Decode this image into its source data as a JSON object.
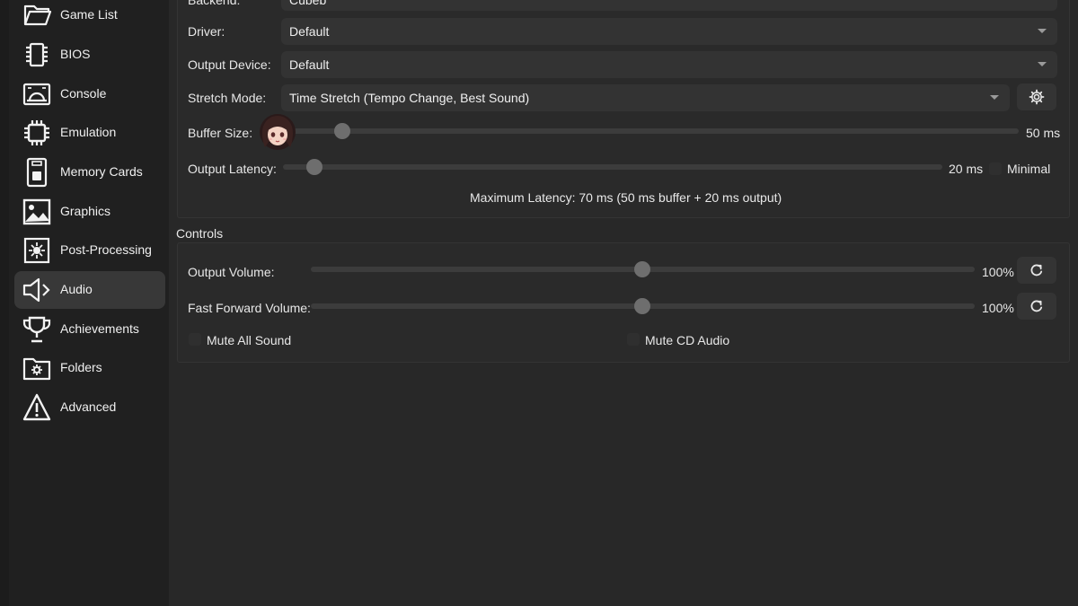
{
  "sidebar": {
    "items": [
      {
        "label": "Game List",
        "icon": "folder-icon"
      },
      {
        "label": "BIOS",
        "icon": "chip-icon"
      },
      {
        "label": "Console",
        "icon": "console-icon"
      },
      {
        "label": "Emulation",
        "icon": "cpu-icon"
      },
      {
        "label": "Memory Cards",
        "icon": "memory-card-icon"
      },
      {
        "label": "Graphics",
        "icon": "image-icon"
      },
      {
        "label": "Post-Processing",
        "icon": "sparkle-icon"
      },
      {
        "label": "Audio",
        "icon": "speaker-icon"
      },
      {
        "label": "Achievements",
        "icon": "trophy-icon"
      },
      {
        "label": "Folders",
        "icon": "folder-gear-icon"
      },
      {
        "label": "Advanced",
        "icon": "warning-icon"
      }
    ],
    "active": "Audio"
  },
  "configuration": {
    "backend_label": "Backend:",
    "backend_value": "Cubeb",
    "driver_label": "Driver:",
    "driver_value": "Default",
    "output_device_label": "Output Device:",
    "output_device_value": "Default",
    "stretch_mode_label": "Stretch Mode:",
    "stretch_mode_value": "Time Stretch (Tempo Change, Best Sound)",
    "buffer_size_label": "Buffer Size:",
    "buffer_size_value": "50 ms",
    "buffer_size_fraction": 0.08,
    "output_latency_label": "Output Latency:",
    "output_latency_value": "20 ms",
    "output_latency_fraction": 0.05,
    "minimal_label": "Minimal",
    "max_latency_text": "Maximum Latency: 70 ms (50 ms buffer + 20 ms output)"
  },
  "controls": {
    "title": "Controls",
    "output_volume_label": "Output Volume:",
    "output_volume_value": "100%",
    "output_volume_fraction": 0.5,
    "ff_volume_label": "Fast Forward Volume:",
    "ff_volume_value": "100%",
    "ff_volume_fraction": 0.5,
    "mute_all_label": "Mute All Sound",
    "mute_cd_label": "Mute CD Audio"
  }
}
